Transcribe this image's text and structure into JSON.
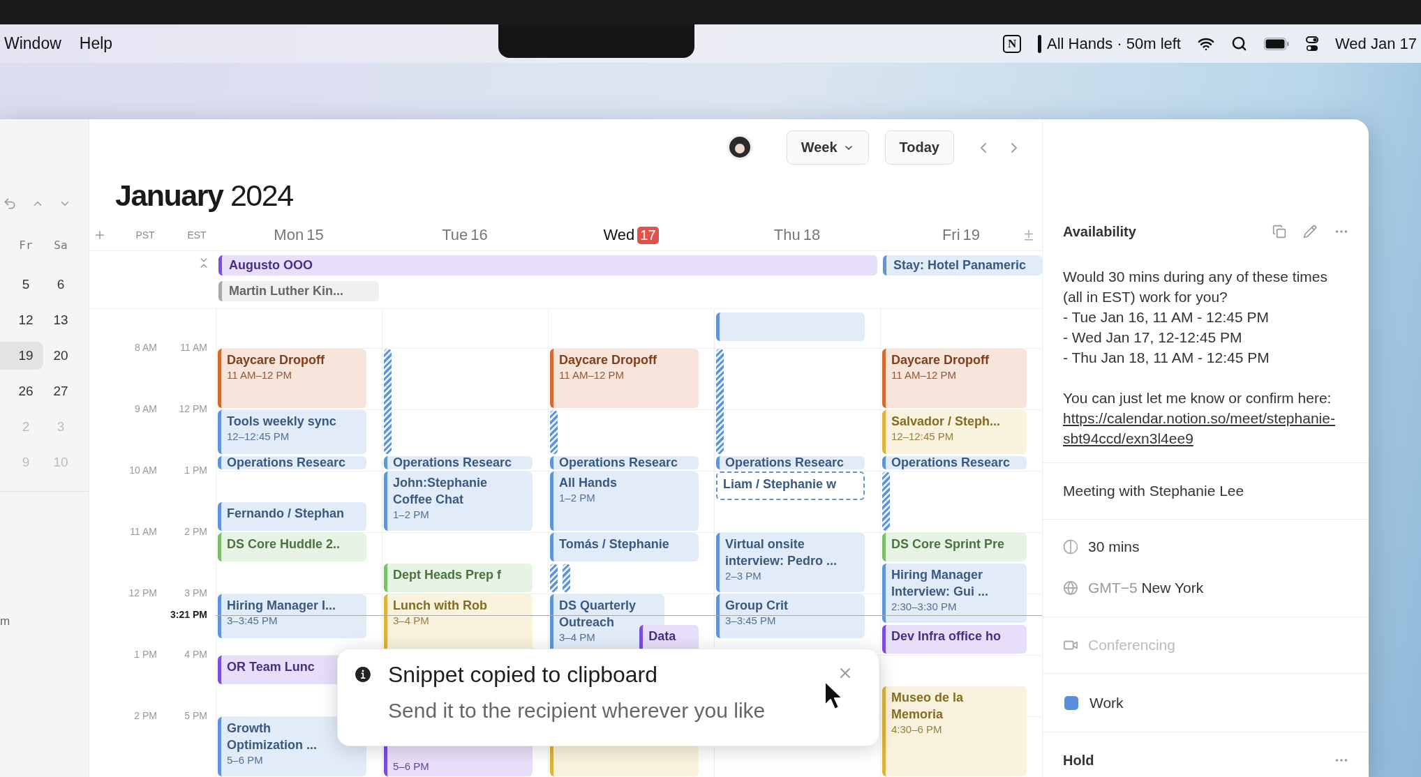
{
  "menu_bar": {
    "menus": [
      "Window",
      "Help"
    ],
    "app_letter": "N",
    "meeting_status": "All Hands · 50m left",
    "clock": "Wed Jan 17"
  },
  "sidebar": {
    "weekdays": [
      "Fr",
      "Sa"
    ],
    "weeks": [
      {
        "days": [
          {
            "label": "5",
            "muted": false
          },
          {
            "label": "6",
            "muted": false
          }
        ],
        "selected": false
      },
      {
        "days": [
          {
            "label": "12",
            "muted": false
          },
          {
            "label": "13",
            "muted": false
          }
        ],
        "selected": false
      },
      {
        "days": [
          {
            "label": "19",
            "muted": false
          },
          {
            "label": "20",
            "muted": false
          }
        ],
        "selected": true
      },
      {
        "days": [
          {
            "label": "26",
            "muted": false
          },
          {
            "label": "27",
            "muted": false
          }
        ],
        "selected": false
      },
      {
        "days": [
          {
            "label": "2",
            "muted": true
          },
          {
            "label": "3",
            "muted": true
          }
        ],
        "selected": false
      },
      {
        "days": [
          {
            "label": "9",
            "muted": true
          },
          {
            "label": "10",
            "muted": true
          }
        ],
        "selected": false
      }
    ],
    "fragment": "m"
  },
  "toolbar": {
    "view": "Week",
    "today": "Today"
  },
  "title": "**January** 2024",
  "timezones": [
    "PST",
    "EST"
  ],
  "days": [
    {
      "name": "Mon",
      "date": "15",
      "today": false,
      "events": [
        {
          "kind": "event",
          "title": "Daycare Dropoff",
          "time": "11 AM–12 PM",
          "color": "#d46a2f"
        },
        {
          "kind": "event",
          "title": "Tools weekly sync",
          "time": "12–12:45 PM",
          "color": "#5f95d6"
        },
        {
          "kind": "event",
          "title": "Operations Researc",
          "color": "#5f95d6"
        },
        {
          "kind": "event",
          "title": "Fernando / Stephan",
          "color": "#5f95d6"
        },
        {
          "kind": "event",
          "title": "DS Core Huddle 2..",
          "color": "#7cbf6a"
        },
        {
          "kind": "event",
          "title": "Hiring Manager I...",
          "time": "3–3:45 PM",
          "color": "#5f95d6"
        },
        {
          "kind": "event",
          "title": "OR Team Lunc",
          "color": "#7c4ddc"
        },
        {
          "kind": "event",
          "title": "Growth Optimization ...",
          "time": "5–6 PM",
          "color": "#5f95d6"
        }
      ]
    },
    {
      "name": "Tue",
      "date": "16",
      "today": false,
      "events": [
        {
          "kind": "stripe",
          "color": "#5f95d6"
        },
        {
          "kind": "event",
          "title": "Operations Researc",
          "color": "#5f95d6"
        },
        {
          "kind": "event",
          "title": "John:Stephanie Coffee Chat",
          "time": "1–2 PM",
          "color": "#5f95d6"
        },
        {
          "kind": "event",
          "title": "Dept Heads Prep f",
          "color": "#7cbf6a"
        },
        {
          "kind": "event",
          "title": "Lunch with Rob",
          "time": "3–4 PM",
          "color": "#dcb43a"
        },
        {
          "kind": "event",
          "time": "5–6 PM",
          "color": "#7c4ddc"
        }
      ]
    },
    {
      "name": "Wed",
      "date": "17",
      "today": true,
      "events": [
        {
          "kind": "event",
          "title": "Daycare Dropoff",
          "time": "11 AM–12 PM",
          "color": "#d46a2f"
        },
        {
          "kind": "stripe",
          "color": "#5f95d6"
        },
        {
          "kind": "event",
          "title": "Operations Researc",
          "color": "#5f95d6"
        },
        {
          "kind": "event",
          "title": "All Hands",
          "time": "1–2 PM",
          "color": "#5f95d6"
        },
        {
          "kind": "event",
          "title": "Tomás / Stephanie",
          "color": "#5f95d6"
        },
        {
          "kind": "stripe",
          "color": "#5f95d6"
        },
        {
          "kind": "stripe",
          "color": "#5f95d6"
        },
        {
          "kind": "event",
          "title": "DS Quarterly Outreach",
          "time": "3–4 PM",
          "color": "#5f95d6"
        },
        {
          "kind": "event",
          "title": "Data",
          "color": "#7c4ddc"
        },
        {
          "kind": "event",
          "color": "#dcb43a"
        }
      ]
    },
    {
      "name": "Thu",
      "date": "18",
      "today": false,
      "events": [
        {
          "kind": "event",
          "color": "#5f95d6"
        },
        {
          "kind": "stripe",
          "color": "#5f95d6"
        },
        {
          "kind": "event",
          "title": "Operations Researc",
          "color": "#5f95d6"
        },
        {
          "kind": "dashed",
          "title": "Liam / Stephanie w",
          "color": "#5f95d6"
        },
        {
          "kind": "event",
          "title": "Virtual onsite interview: Pedro ...",
          "time": "2–3 PM",
          "color": "#5f95d6"
        },
        {
          "kind": "event",
          "title": "Group Crit",
          "time": "3–3:45 PM",
          "color": "#5f95d6"
        }
      ]
    },
    {
      "name": "Fri",
      "date": "19",
      "today": false,
      "events": [
        {
          "kind": "event",
          "title": "Daycare Dropoff",
          "time": "11 AM–12 PM",
          "color": "#d46a2f"
        },
        {
          "kind": "event",
          "title": "Salvador / Steph...",
          "time": "12–12:45 PM",
          "color": "#dcb43a"
        },
        {
          "kind": "event",
          "title": "Operations Researc",
          "color": "#5f95d6"
        },
        {
          "kind": "stripe",
          "color": "#5f95d6"
        },
        {
          "kind": "event",
          "title": "DS Core Sprint Pre",
          "color": "#7cbf6a"
        },
        {
          "kind": "event",
          "title": "Hiring Manager Interview: Gui ...",
          "time": "2:30–3:30 PM",
          "color": "#5f95d6"
        },
        {
          "kind": "event",
          "title": "Dev Infra office ho",
          "color": "#7c4ddc"
        },
        {
          "kind": "event",
          "title": "Museo de la Memoria",
          "time": "4:30–6 PM",
          "color": "#dcb43a"
        }
      ]
    }
  ],
  "all_day": [
    {
      "title": "Augusto OOO",
      "color": "#7c4ddc"
    },
    {
      "title": "Martin Luther Kin...",
      "color": "#a9a9a9"
    },
    {
      "title": "Stay: Hotel Panameric",
      "color": "#5f95d6"
    }
  ],
  "hours": [
    {
      "pst": "8 AM",
      "est": "11 AM"
    },
    {
      "pst": "9 AM",
      "est": "12 PM"
    },
    {
      "pst": "10 AM",
      "est": "1 PM"
    },
    {
      "pst": "11 AM",
      "est": "2 PM"
    },
    {
      "pst": "12 PM",
      "est": "3 PM"
    },
    {
      "pst": "1 PM",
      "est": "4 PM"
    },
    {
      "pst": "2 PM",
      "est": "5 PM"
    }
  ],
  "now": {
    "label": "3:21 PM"
  },
  "toast": {
    "title": "Snippet copied to clipboard",
    "message": "Send it to the recipient wherever you like"
  },
  "panel": {
    "title": "Availability",
    "message": "Would 30 mins during any of these times (all in EST) work for you?\n- Tue Jan 16, 11 AM - 12:45 PM\n- Wed Jan 17, 12-12:45 PM\n- Thu Jan 18, 11 AM - 12:45 PM\n\nYou can just let me know or confirm here:",
    "link": "https://calendar.notion.so/meet/stephanie-sbt94ccd/exn3l4ee9",
    "meeting_title": "Meeting with Stephanie Lee",
    "duration": "30 mins",
    "timezone_offset": "GMT−5",
    "timezone_city": "New York",
    "conferencing": {
      "placeholder": "Conferencing"
    },
    "calendar": {
      "name": "Work",
      "color": "#5b8fd9"
    },
    "hold_title": "Hold"
  }
}
